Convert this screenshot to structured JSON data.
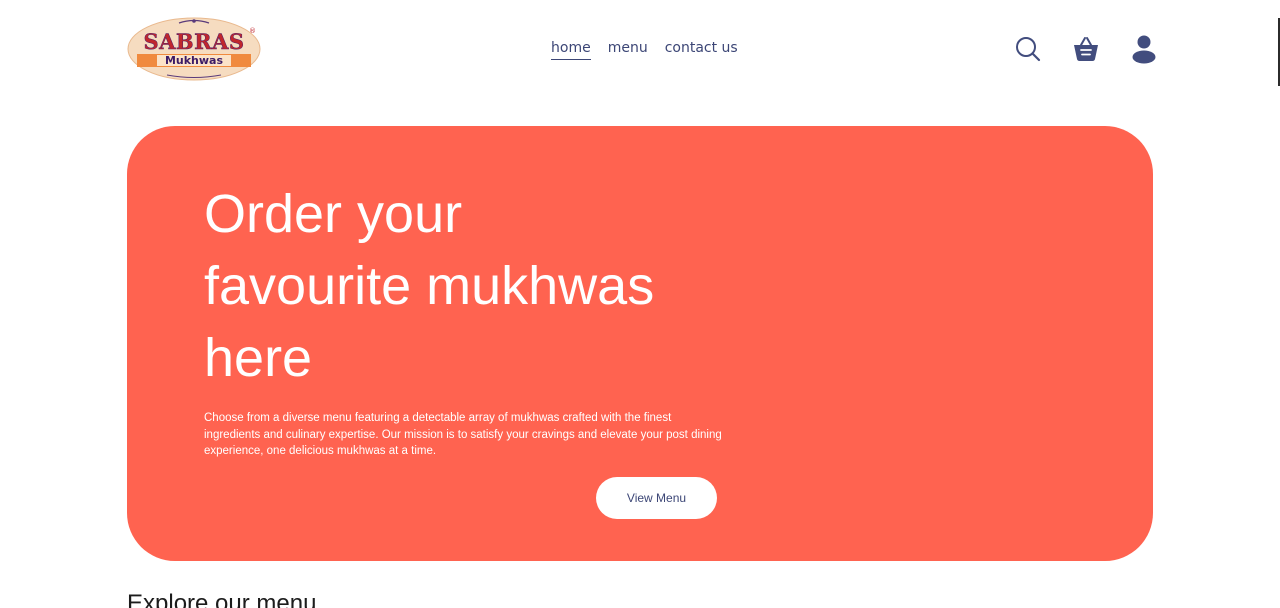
{
  "brand": {
    "logo_text": "SABRAS",
    "logo_subtext": "Mukhwas",
    "logo_mark": "®"
  },
  "nav": {
    "items": [
      {
        "label": "home",
        "active": true
      },
      {
        "label": "menu",
        "active": false
      },
      {
        "label": "contact us",
        "active": false
      }
    ]
  },
  "header_icons": [
    "search-icon",
    "basket-icon",
    "user-icon"
  ],
  "hero": {
    "title_lines": [
      "Order your",
      "favourite mukhwas",
      "here"
    ],
    "description": "Choose from a diverse menu featuring a detectable array of mukhwas crafted with the finest ingredients and culinary expertise. Our mission is to satisfy your cravings and elevate your post dining experience, one delicious mukhwas at a time.",
    "button_label": "View Menu"
  },
  "explore": {
    "heading": "Explore our menu"
  },
  "colors": {
    "hero_background": "#ff6350",
    "nav_text": "#3c4676",
    "icon_color": "#424d7e",
    "white": "#ffffff"
  }
}
